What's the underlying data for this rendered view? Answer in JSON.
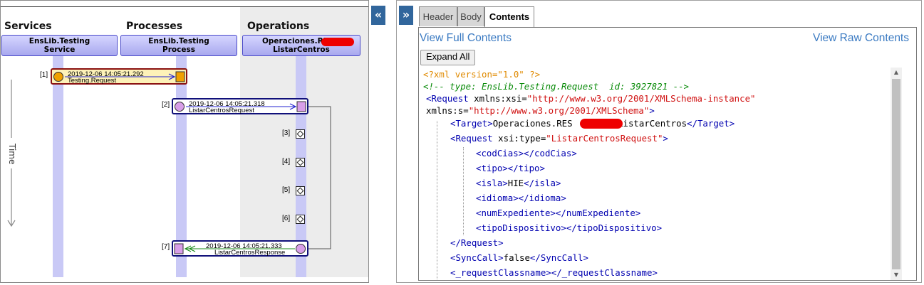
{
  "trace": {
    "columns": [
      {
        "title": "Services",
        "actor_line1": "EnsLib.Testing",
        "actor_line2": "Service"
      },
      {
        "title": "Processes",
        "actor_line1": "EnsLib.Testing",
        "actor_line2": "Process"
      },
      {
        "title": "Operations",
        "actor_line1": "Operaciones.REST.",
        "actor_line2": "ListarCentros"
      }
    ],
    "time_label": "Time",
    "messages": [
      {
        "index": "[1]",
        "timestamp": "2019-12-06 14:05:21.292",
        "name": "Testing.Request"
      },
      {
        "index": "[2]",
        "timestamp": "2019-12-06 14:05:21.318",
        "name": "ListarCentrosRequest"
      },
      {
        "index": "[7]",
        "timestamp": "2019-12-06 14:05:21.333",
        "name": "ListarCentrosResponse"
      }
    ],
    "events": [
      "[3]",
      "[4]",
      "[5]",
      "[6]"
    ]
  },
  "toggles": {
    "collapse_left": "«",
    "collapse_right": "»"
  },
  "tabs": [
    {
      "label": "Header",
      "active": false
    },
    {
      "label": "Body",
      "active": false
    },
    {
      "label": "Contents",
      "active": true
    }
  ],
  "contents": {
    "view_full": "View Full Contents",
    "view_raw": "View Raw Contents",
    "expand_all": "Expand All",
    "xml": {
      "decl": "<?xml version=\"1.0\" ?>",
      "comment": "<!-- type: EnsLib.Testing.Request  id: 3927821 -->",
      "request_open": "<Request",
      "xsi_attr": " xmlns:xsi=",
      "xsi_val": "\"http://www.w3.org/2001/XMLSchema-instance\"",
      "s_attr": "xmlns:s=",
      "s_val": "\"http://www.w3.org/2001/XMLSchema\"",
      "gt": ">",
      "target_open": "<Target>",
      "target_text_a": "Operaciones.RES",
      "target_text_b": ".ListarCentros",
      "target_close": "</Target>",
      "inner_open": "<Request",
      "type_attr": " xsi:type=",
      "type_val": "\"ListarCentrosRequest\"",
      "codcias": "<codCias></codCias>",
      "tipo": "<tipo></tipo>",
      "isla_open": "<isla>",
      "isla_text": "HIE",
      "isla_close": "</isla>",
      "idioma": "<idioma></idioma>",
      "numexp": "<numExpediente></numExpediente>",
      "tipodisp": "<tipoDispositivo></tipoDispositivo>",
      "inner_close": "</Request>",
      "sync_open": "<SyncCall>",
      "sync_text": "false",
      "sync_close": "</SyncCall>",
      "reqclass": "<_requestClassname></_requestClassname>"
    }
  },
  "scroll": {
    "up": "▲",
    "down": "▼"
  },
  "colors": {
    "accent": "#31669c",
    "link": "#3a7ac2",
    "tag": "#0000b0",
    "attr_value": "#d01010"
  }
}
